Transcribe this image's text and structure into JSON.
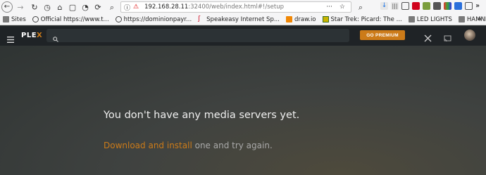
{
  "browser": {
    "url_host": "192.168.28.11",
    "url_path": ":32400/web/index.html#!/setup",
    "bookmarks": [
      {
        "label": "Sites",
        "icon": "folder-icon",
        "color": "#7a7a7a"
      },
      {
        "label": "Official https://www.t...",
        "icon": "globe-icon",
        "color": "#444444"
      },
      {
        "label": "https://dominionpayr...",
        "icon": "globe-icon",
        "color": "#444444"
      },
      {
        "label": "Speakeasy Internet Sp...",
        "icon": "speakeasy-icon",
        "color": "#d0021b"
      },
      {
        "label": "draw.io",
        "icon": "drawio-icon",
        "color": "#f08705"
      },
      {
        "label": "Star Trek: Picard: The ...",
        "icon": "startrek-icon",
        "color": "#3a6b1f"
      },
      {
        "label": "LED LIGHTS",
        "icon": "folder-icon",
        "color": "#7a7a7a"
      },
      {
        "label": "HAMNET",
        "icon": "folder-icon",
        "color": "#7a7a7a"
      }
    ]
  },
  "plex": {
    "logo_main": "PLE",
    "logo_accent": "X",
    "premium_label": "GO PREMIUM",
    "accent_color": "#cc7b19"
  },
  "main": {
    "title": "You don't have any media servers yet.",
    "link_text": "Download and install",
    "after_link": " one and try again."
  }
}
